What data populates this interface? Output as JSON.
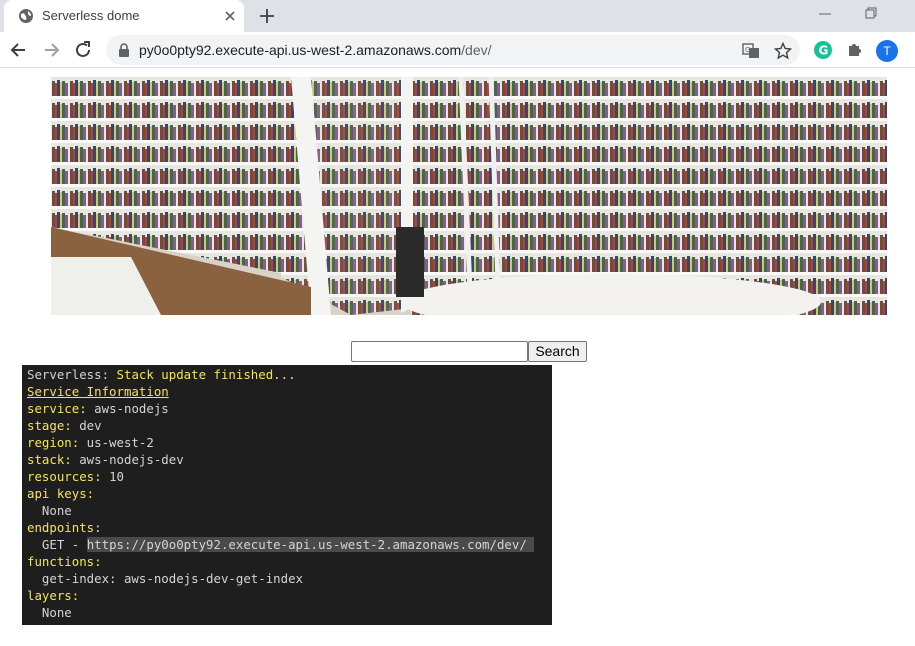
{
  "browser": {
    "tab_title": "Serverless dome",
    "url_host": "py0o0pty92.execute-api.us-west-2.amazonaws.com",
    "url_path": "/dev/",
    "profile_initial": "T",
    "icons": [
      "globe-icon",
      "close-icon",
      "plus-icon",
      "minimize-icon",
      "restore-icon",
      "back-arrow-icon",
      "forward-arrow-icon",
      "reload-icon",
      "lock-icon",
      "translate-icon",
      "star-icon",
      "grammarly-icon",
      "puzzle-icon"
    ]
  },
  "page": {
    "hero_alt": "bookshelves-image",
    "search_placeholder": "",
    "search_button": "Search"
  },
  "terminal": {
    "prefix": "Serverless: ",
    "status": "Stack update finished...",
    "header": "Service Information",
    "service_key": "service:",
    "service_val": " aws-nodejs",
    "stage_key": "stage:",
    "stage_val": " dev",
    "region_key": "region:",
    "region_val": " us-west-2",
    "stack_key": "stack:",
    "stack_val": " aws-nodejs-dev",
    "resources_key": "resources:",
    "resources_val": " 10",
    "apikeys_key": "api keys:",
    "apikeys_val": "  None",
    "endpoints_key": "endpoints:",
    "endpoint_method": "  GET - ",
    "endpoint_url": "https://py0o0pty92.execute-api.us-west-2.amazonaws.com/dev/ ",
    "functions_key": "functions:",
    "function_val": "  get-index: aws-nodejs-dev-get-index",
    "layers_key": "layers:",
    "layers_val": "  None"
  },
  "colors": {
    "terminal_bg": "#1e1e1e",
    "terminal_key": "#f5e35b",
    "terminal_text": "#d4d4d4",
    "tabstrip_bg": "#dee1e6",
    "omnibox_bg": "#f1f3f4"
  }
}
